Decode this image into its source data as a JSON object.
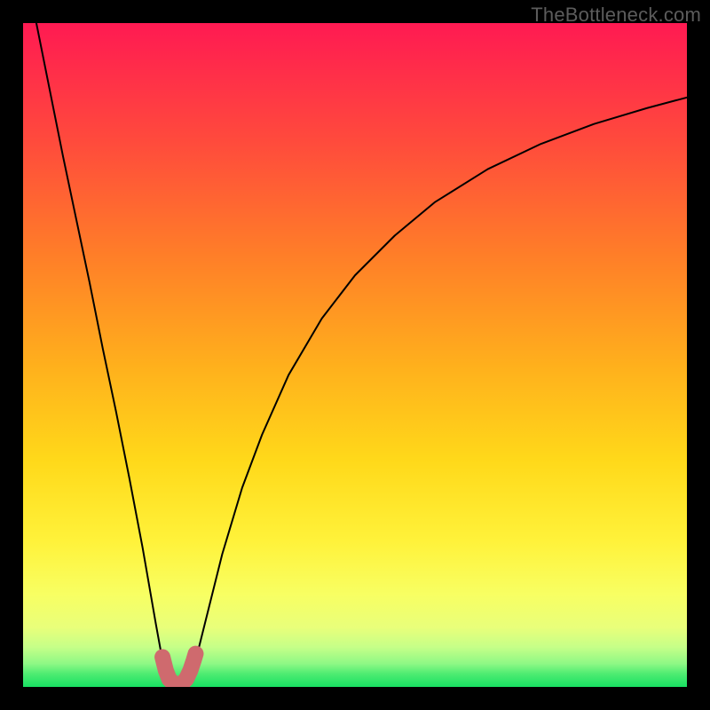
{
  "watermark": "TheBottleneck.com",
  "chart_data": {
    "type": "line",
    "title": "",
    "xlabel": "",
    "ylabel": "",
    "xlim": [
      0,
      1000
    ],
    "ylim": [
      0,
      1000
    ],
    "legend": false,
    "grid": false,
    "background_gradient": {
      "top_color": "#ff1a52",
      "mid_colors": [
        "#ff6d2c",
        "#ffa61f",
        "#ffd91a",
        "#fff43a",
        "#f7ff6a",
        "#c9ff87"
      ],
      "bottom_color": "#18e063"
    },
    "series": [
      {
        "name": "left-branch",
        "x": [
          20,
          40,
          60,
          80,
          100,
          120,
          140,
          160,
          180,
          200,
          210,
          220
        ],
        "y": [
          1000,
          900,
          800,
          705,
          610,
          510,
          415,
          315,
          210,
          95,
          40,
          10
        ],
        "color": "#000000",
        "stroke_width": 2
      },
      {
        "name": "right-branch",
        "x": [
          250,
          260,
          280,
          300,
          330,
          360,
          400,
          450,
          500,
          560,
          620,
          700,
          780,
          860,
          940,
          1000
        ],
        "y": [
          10,
          40,
          120,
          200,
          300,
          380,
          470,
          555,
          620,
          680,
          730,
          780,
          818,
          848,
          872,
          888
        ],
        "color": "#000000",
        "stroke_width": 2
      },
      {
        "name": "u-bottom",
        "x": [
          210,
          215,
          220,
          228,
          238,
          246,
          252,
          257,
          260
        ],
        "y": [
          45,
          25,
          12,
          4,
          4,
          12,
          25,
          40,
          50
        ],
        "color": "#cf6a6e",
        "stroke_width": 18
      }
    ],
    "annotations": []
  }
}
